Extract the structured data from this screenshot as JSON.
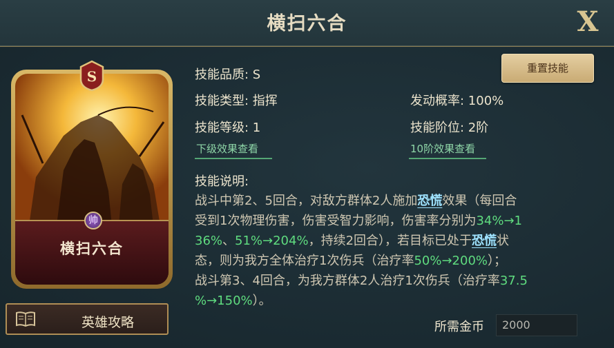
{
  "title": "横扫六合",
  "close_label": "X",
  "card": {
    "grade": "S",
    "name": "横扫六合",
    "command_icon_glyph": "帅"
  },
  "guide_button_label": "英雄攻略",
  "reset_button_label": "重置技能",
  "info": {
    "quality": "技能品质: S",
    "type": "技能类型: 指挥",
    "probability": "发动概率: 100%",
    "level": "技能等级: 1",
    "tier": "技能阶位: 2阶",
    "next_level_link": "下级效果查看",
    "tier10_link": "10阶效果查看"
  },
  "description": {
    "title": "技能说明:",
    "l1a": "战斗中第2、5回合，对敌方群体2人施加",
    "l1kw": "恐慌",
    "l1b": "效果（每回合",
    "l2a": "受到1次物理伤害，伤害受智力影响，伤害率分别为",
    "l2g": "34%→1",
    "l3g1": "36%",
    "l3a": "、",
    "l3g2": "51%→204%",
    "l3b": "，持续2回合），若目标已处于",
    "l3kw": "恐慌",
    "l3c": "状",
    "l4a": "态，则为我方全体治疗1次伤兵（治疗率",
    "l4g": "50%→200%",
    "l4b": "）；",
    "l5a": "战斗第3、4回合，为我方群体2人治疗1次伤兵（治疗率",
    "l5g": "37.5",
    "l6g": "%→150%",
    "l6b": "）。"
  },
  "cost": {
    "label": "所需金币",
    "value": "2000"
  },
  "colors": {
    "highlight_green": "#5fdc7f",
    "keyword_cyan": "#9fe3ff",
    "link_green": "#8fd7a8",
    "gold": "#d8c591"
  }
}
